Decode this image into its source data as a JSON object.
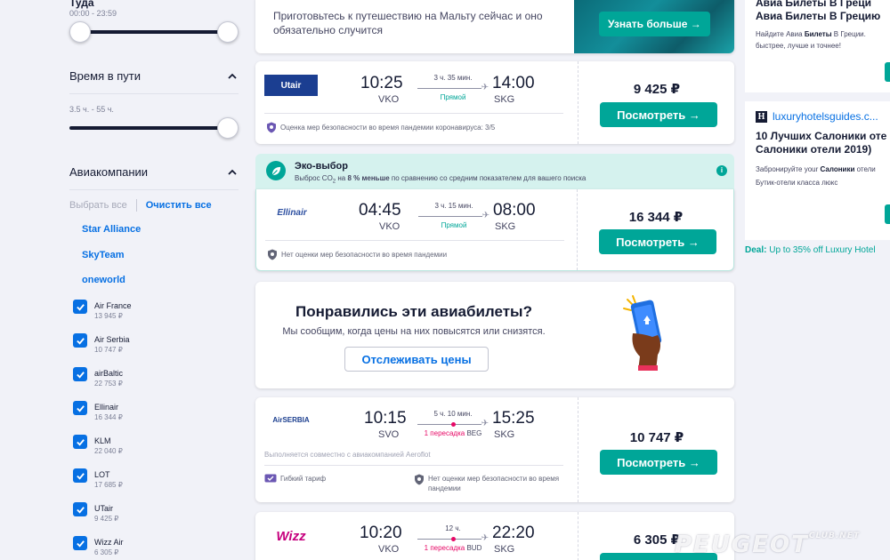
{
  "sidebar": {
    "departure": {
      "title": "Туда",
      "range": "00:00 - 23:59"
    },
    "duration": {
      "title": "Время в пути",
      "range": "3.5 ч. - 55 ч."
    },
    "airlines": {
      "title": "Авиакомпании",
      "select_all": "Выбрать все",
      "clear_all": "Очистить все",
      "alliances": [
        "Star Alliance",
        "SkyTeam",
        "oneworld"
      ],
      "items": [
        {
          "name": "Air France",
          "price": "13 945 ₽"
        },
        {
          "name": "Air Serbia",
          "price": "10 747 ₽"
        },
        {
          "name": "airBaltic",
          "price": "22 753 ₽"
        },
        {
          "name": "Ellinair",
          "price": "16 344 ₽"
        },
        {
          "name": "KLM",
          "price": "22 040 ₽"
        },
        {
          "name": "LOT",
          "price": "17 685 ₽"
        },
        {
          "name": "UTair",
          "price": "9 425 ₽"
        },
        {
          "name": "Wizz Air",
          "price": "6 305 ₽"
        }
      ]
    }
  },
  "promo": {
    "text": "Приготовьтесь к путешествию на Мальту сейчас и оно обязательно случится",
    "button": "Узнать больше →"
  },
  "eco": {
    "title": "Эко-выбор",
    "subtitle_pre": "Выброс CO",
    "subtitle_sub": "2",
    "subtitle_mid": " на ",
    "subtitle_bold": "8 % меньше",
    "subtitle_post": " по сравнению со средним показателем для вашего поиска",
    "info": "i"
  },
  "flights": [
    {
      "airline": "Utair",
      "dep_time": "10:25",
      "dep_code": "VKO",
      "arr_time": "14:00",
      "arr_code": "SKG",
      "duration": "3 ч. 35 мин.",
      "stops": "Прямой",
      "safety": "Оценка мер безопасности во время пандемии коронавируса: 3/5",
      "price": "9 425 ₽",
      "button": "Посмотреть →"
    },
    {
      "airline": "Ellinair",
      "dep_time": "04:45",
      "dep_code": "VKO",
      "arr_time": "08:00",
      "arr_code": "SKG",
      "duration": "3 ч. 15 мин.",
      "stops": "Прямой",
      "safety": "Нет оценки мер безопасности во время пандемии",
      "price": "16 344 ₽",
      "button": "Посмотреть →"
    },
    {
      "airline": "AirSERBIA",
      "dep_time": "10:15",
      "dep_code": "SVO",
      "arr_time": "15:25",
      "arr_code": "SKG",
      "duration": "5 ч. 10 мин.",
      "stops": "1 пересадка",
      "stop_code": "BEG",
      "operated": "Выполняется совместно с авиакомпанией Aeroflot",
      "tariff": "Гибкий тариф",
      "safety": "Нет оценки мер безопасности во время пандемии",
      "price": "10 747 ₽",
      "button": "Посмотреть →"
    },
    {
      "airline": "Wizz",
      "dep_time": "10:20",
      "dep_code": "VKO",
      "arr_time": "22:20",
      "arr_code": "SKG",
      "duration": "12 ч.",
      "stops": "1 пересадка",
      "stop_code": "BUD",
      "price": "6 305 ₽"
    }
  ],
  "tracker": {
    "title": "Понравились эти авиабилеты?",
    "subtitle": "Мы сообщим, когда цены на них повысятся или снизятся.",
    "button": "Отслеживать цены"
  },
  "ads": {
    "ad1": {
      "title1": "Авиа Билеты В Греци",
      "title2": "Авиа Билеты В Грецию",
      "body1_pre": "Найдите Авиа ",
      "body1_bold": "Билеты",
      "body1_post": " В Греции.",
      "body2": "быстрее, лучше и точнее!"
    },
    "ad2": {
      "domain": "luxuryhotelsguides.c...",
      "title1": "10 Лучших Салоники оте",
      "title2": "Салоники отели 2019)",
      "body1_pre": "Забронируйте your ",
      "body1_bold": "Салоники",
      "body1_post": " отели",
      "body2": "Бутик-отели класса люкс"
    },
    "deal_label": "Deal:",
    "deal_text": " Up to 35% off Luxury Hotel"
  },
  "watermark": {
    "text": "PEUGEOT",
    "sup": "CLUB.NET"
  },
  "colors": {
    "accent": "#00a698",
    "link": "#0770e3",
    "text": "#151b33",
    "stop": "#e70866"
  }
}
